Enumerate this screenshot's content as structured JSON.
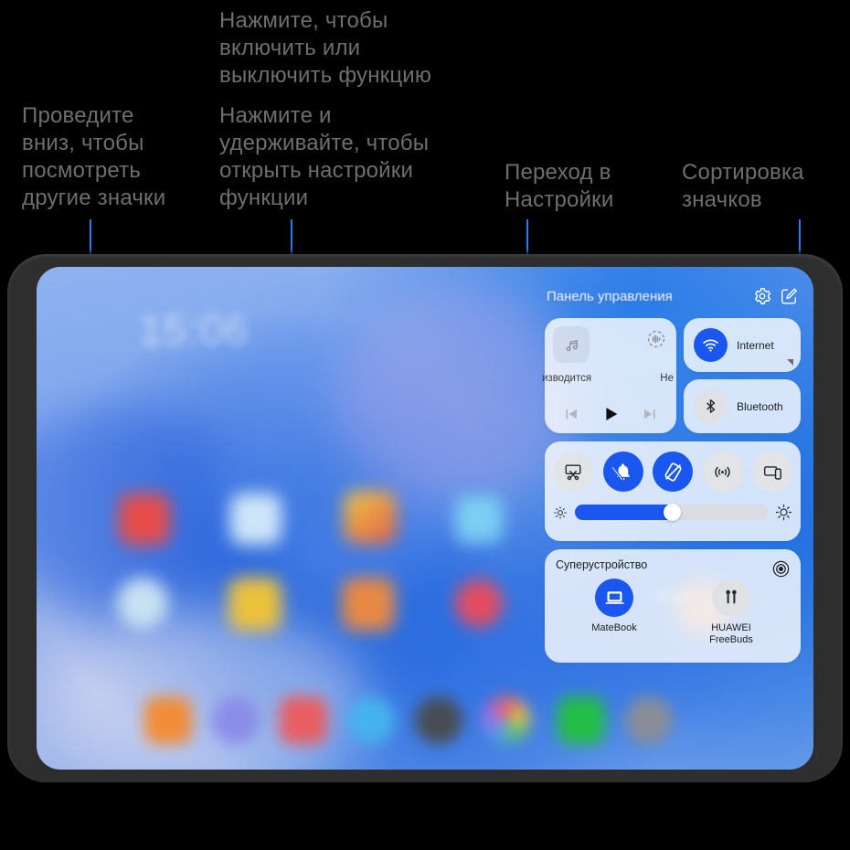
{
  "annotations": {
    "swipe_down": "Проведите\nвниз, чтобы\nпосмотреть\nдругие значки",
    "tap_toggle": "Нажмите, чтобы\nвключить или\nвыключить функцию",
    "tap_hold": "Нажмите и\nудерживайте, чтобы\nоткрыть настройки\nфункции",
    "go_settings": "Переход в\nНастройки",
    "sort_icons": "Сортировка\nзначков"
  },
  "control_panel": {
    "title": "Панель управления",
    "settings_icon": "gear-icon",
    "edit_icon": "edit-square-icon",
    "media": {
      "album_icon": "music-note-icon",
      "cast_icon": "audio-cast-icon",
      "status_left": "изводится",
      "status_right": "Не",
      "prev_icon": "previous-track-icon",
      "play_icon": "play-icon",
      "next_icon": "next-track-icon"
    },
    "connectivity": [
      {
        "label": "Internet",
        "icon": "wifi-icon",
        "active": true
      },
      {
        "label": "Bluetooth",
        "icon": "bluetooth-icon",
        "active": false
      }
    ],
    "toggles": [
      {
        "name": "screenshot-icon",
        "active": false
      },
      {
        "name": "mute-bell-icon",
        "active": true
      },
      {
        "name": "rotation-lock-icon",
        "active": true
      },
      {
        "name": "nfc-icon",
        "active": false
      },
      {
        "name": "screen-cast-icon",
        "active": false
      }
    ],
    "brightness": {
      "low_icon": "brightness-low-icon",
      "high_icon": "brightness-high-icon",
      "value_percent": 50
    },
    "super_device": {
      "title": "Суперустройство",
      "target_icon": "super-device-target-icon",
      "devices": [
        {
          "name": "MateBook",
          "icon": "laptop-icon",
          "active": true
        },
        {
          "name": "HUAWEI\nFreeBuds",
          "icon": "earbuds-icon",
          "active": false
        }
      ]
    }
  },
  "home_screen": {
    "clock": "15:06"
  },
  "colors": {
    "accent_blue": "#1a56f0",
    "leader_line": "#2f7bf6",
    "caption_gray": "#6e6e6e",
    "bezel": "#2e2e2e"
  }
}
